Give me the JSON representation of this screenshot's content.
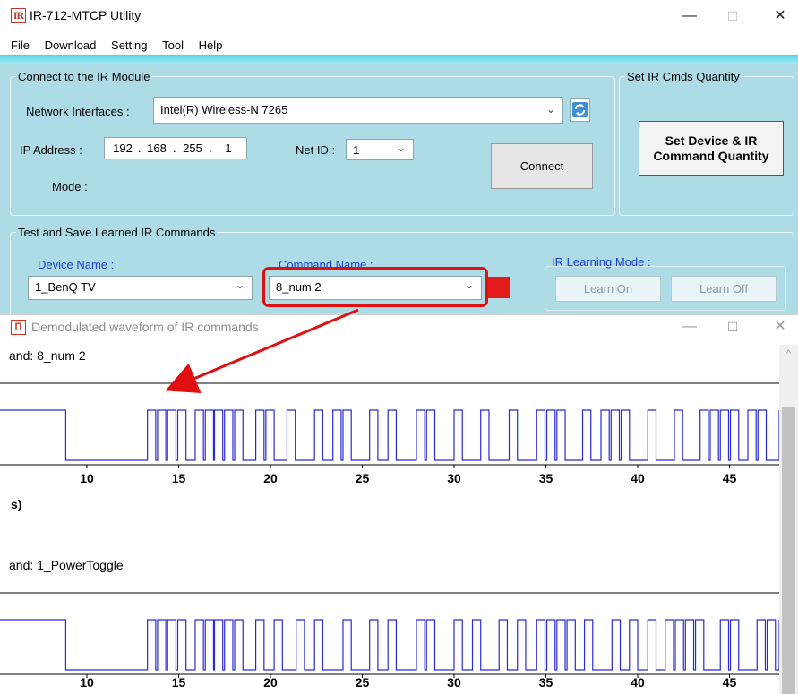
{
  "app": {
    "title": "IR-712-MTCP Utility",
    "logo_text": "IR",
    "window_controls": {
      "minimize": "—",
      "maximize": "☐",
      "close": "✕"
    }
  },
  "menu": [
    "File",
    "Download",
    "Setting",
    "Tool",
    "Help"
  ],
  "connect": {
    "legend": "Connect to the IR Module",
    "network_label": "Network Interfaces :",
    "network_value": "Intel(R) Wireless-N 7265",
    "refresh_icon": "refresh-icon",
    "ip_label": "IP Address :",
    "ip": [
      "192",
      "168",
      "255",
      "1"
    ],
    "ip_dots": ".",
    "netid_label": "Net ID :",
    "netid_value": "1",
    "mode_label": "Mode :",
    "connect_button": "Connect"
  },
  "quantity": {
    "legend": "Set IR Cmds Quantity",
    "button_line1": "Set Device & IR",
    "button_line2": "Command Quantity"
  },
  "test": {
    "legend": "Test and Save Learned IR Commands",
    "device_label": "Device Name :",
    "device_value": "1_BenQ TV",
    "command_label": "Command Name :",
    "command_value": "8_num 2",
    "status_color": "#e41b1b",
    "learning_label": "IR Learning Mode :",
    "learn_on": "Learn On",
    "learn_off": "Learn Off"
  },
  "waveform_window": {
    "title": "Demodulated waveform of IR commands",
    "icon": "pulse-icon",
    "scroll_up": "^",
    "line_color": "#2a2ad8",
    "plots": [
      {
        "title": "and: 8_num 2",
        "ticks": [
          10,
          15,
          20,
          25,
          30,
          35,
          40,
          45
        ],
        "unit_text": "s)",
        "segments": [
          [
            5.5,
            1
          ],
          [
            8.85,
            0
          ],
          [
            13.3,
            1
          ],
          [
            13.75,
            0
          ],
          [
            13.85,
            1
          ],
          [
            14.3,
            0
          ],
          [
            14.4,
            1
          ],
          [
            14.85,
            0
          ],
          [
            14.95,
            1
          ],
          [
            15.4,
            0
          ],
          [
            15.9,
            1
          ],
          [
            16.35,
            0
          ],
          [
            16.45,
            1
          ],
          [
            16.9,
            0
          ],
          [
            16.95,
            1
          ],
          [
            17.4,
            0
          ],
          [
            17.5,
            1
          ],
          [
            17.95,
            0
          ],
          [
            18.05,
            1
          ],
          [
            18.5,
            0
          ],
          [
            19.2,
            1
          ],
          [
            19.65,
            0
          ],
          [
            19.75,
            1
          ],
          [
            20.2,
            0
          ],
          [
            20.9,
            1
          ],
          [
            21.35,
            0
          ],
          [
            22.4,
            1
          ],
          [
            22.85,
            0
          ],
          [
            23.4,
            1
          ],
          [
            23.85,
            0
          ],
          [
            23.95,
            1
          ],
          [
            24.4,
            0
          ],
          [
            25.4,
            1
          ],
          [
            25.85,
            0
          ],
          [
            26.4,
            1
          ],
          [
            26.85,
            0
          ],
          [
            27.95,
            1
          ],
          [
            28.4,
            0
          ],
          [
            28.5,
            1
          ],
          [
            28.95,
            0
          ],
          [
            30.0,
            1
          ],
          [
            30.45,
            0
          ],
          [
            31.45,
            1
          ],
          [
            31.9,
            0
          ],
          [
            33.0,
            1
          ],
          [
            33.45,
            0
          ],
          [
            34.5,
            1
          ],
          [
            34.95,
            0
          ],
          [
            35.05,
            1
          ],
          [
            35.5,
            0
          ],
          [
            35.6,
            1
          ],
          [
            36.05,
            0
          ],
          [
            37.0,
            1
          ],
          [
            37.45,
            0
          ],
          [
            38.0,
            1
          ],
          [
            38.45,
            0
          ],
          [
            38.55,
            1
          ],
          [
            39.0,
            0
          ],
          [
            39.1,
            1
          ],
          [
            39.55,
            0
          ],
          [
            40.55,
            1
          ],
          [
            41.0,
            0
          ],
          [
            42.0,
            1
          ],
          [
            42.45,
            0
          ],
          [
            43.4,
            1
          ],
          [
            43.85,
            0
          ],
          [
            43.95,
            1
          ],
          [
            44.4,
            0
          ],
          [
            44.5,
            1
          ],
          [
            44.95,
            0
          ],
          [
            45.05,
            1
          ],
          [
            45.5,
            0
          ],
          [
            46.0,
            1
          ],
          [
            46.45,
            0
          ],
          [
            46.55,
            1
          ],
          [
            47.0,
            0
          ],
          [
            48.0,
            1
          ]
        ]
      },
      {
        "title": "and: 1_PowerToggle",
        "ticks": [
          10,
          15,
          20,
          25,
          30,
          35,
          40,
          45
        ],
        "segments": [
          [
            5.5,
            1
          ],
          [
            8.85,
            0
          ],
          [
            13.3,
            1
          ],
          [
            13.75,
            0
          ],
          [
            13.85,
            1
          ],
          [
            14.3,
            0
          ],
          [
            14.4,
            1
          ],
          [
            14.85,
            0
          ],
          [
            14.95,
            1
          ],
          [
            15.4,
            0
          ],
          [
            15.9,
            1
          ],
          [
            16.35,
            0
          ],
          [
            16.45,
            1
          ],
          [
            16.9,
            0
          ],
          [
            16.95,
            1
          ],
          [
            17.4,
            0
          ],
          [
            17.5,
            1
          ],
          [
            17.95,
            0
          ],
          [
            18.05,
            1
          ],
          [
            18.5,
            0
          ],
          [
            19.2,
            1
          ],
          [
            19.65,
            0
          ],
          [
            20.2,
            1
          ],
          [
            20.65,
            0
          ],
          [
            21.4,
            1
          ],
          [
            21.85,
            0
          ],
          [
            22.4,
            1
          ],
          [
            22.85,
            0
          ],
          [
            23.95,
            1
          ],
          [
            24.4,
            0
          ],
          [
            25.4,
            1
          ],
          [
            25.85,
            0
          ],
          [
            26.4,
            1
          ],
          [
            26.85,
            0
          ],
          [
            27.95,
            1
          ],
          [
            28.4,
            0
          ],
          [
            28.5,
            1
          ],
          [
            28.95,
            0
          ],
          [
            30.0,
            1
          ],
          [
            30.45,
            0
          ],
          [
            31.0,
            1
          ],
          [
            31.45,
            0
          ],
          [
            32.45,
            1
          ],
          [
            32.9,
            0
          ],
          [
            33.45,
            1
          ],
          [
            33.9,
            0
          ],
          [
            34.5,
            1
          ],
          [
            34.95,
            0
          ],
          [
            35.05,
            1
          ],
          [
            35.5,
            0
          ],
          [
            35.6,
            1
          ],
          [
            36.05,
            0
          ],
          [
            36.15,
            1
          ],
          [
            36.6,
            0
          ],
          [
            37.1,
            1
          ],
          [
            37.55,
            0
          ],
          [
            38.6,
            1
          ],
          [
            39.05,
            0
          ],
          [
            39.55,
            1
          ],
          [
            40.0,
            0
          ],
          [
            40.55,
            1
          ],
          [
            41.0,
            0
          ],
          [
            41.5,
            1
          ],
          [
            41.95,
            0
          ],
          [
            42.05,
            1
          ],
          [
            42.5,
            0
          ],
          [
            42.6,
            1
          ],
          [
            43.05,
            0
          ],
          [
            43.15,
            1
          ],
          [
            43.6,
            0
          ],
          [
            44.5,
            1
          ],
          [
            44.95,
            0
          ],
          [
            45.05,
            1
          ],
          [
            45.5,
            0
          ],
          [
            46.5,
            1
          ],
          [
            46.95,
            0
          ],
          [
            47.05,
            1
          ],
          [
            47.5,
            0
          ],
          [
            48.0,
            1
          ]
        ]
      }
    ]
  }
}
